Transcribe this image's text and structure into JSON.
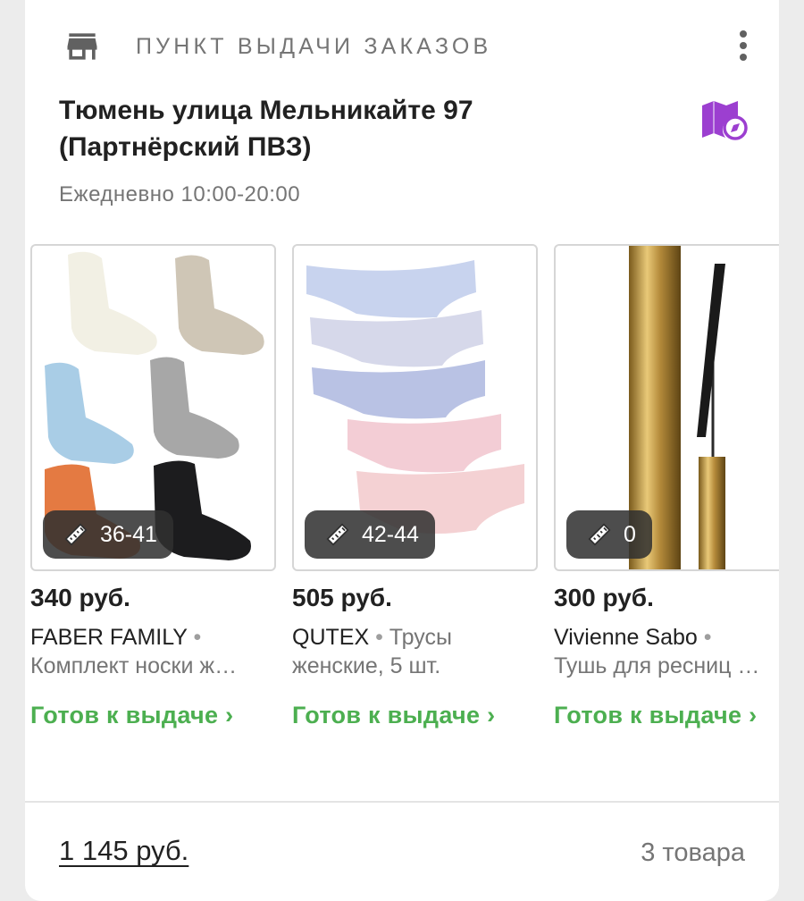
{
  "pickup": {
    "title": "ПУНКТ ВЫДАЧИ ЗАКАЗОВ",
    "address": "Тюмень улица Мельникайте 97 (Партнёрский ПВЗ)",
    "hours": "Ежедневно 10:00-20:00",
    "icons": {
      "store": "store-icon",
      "menu": "more-vert-icon",
      "map": "map-compass-icon"
    },
    "accent_color": "#9c3fd0"
  },
  "products": [
    {
      "size": "36-41",
      "price": "340 руб.",
      "brand": "FABER FAMILY",
      "separator": " •",
      "line2": "Комплект носки ж…",
      "status": "Готов к выдаче ›",
      "image": "socks"
    },
    {
      "size": "42-44",
      "price": "505 руб.",
      "brand": "QUTEX",
      "separator": " •",
      "line1_rest": " Трусы",
      "line2": "женские, 5 шт.",
      "status": "Готов к выдаче ›",
      "image": "briefs"
    },
    {
      "size": "0",
      "price": "300 руб.",
      "brand": "Vivienne Sabo",
      "separator": " •",
      "line2": "Тушь для ресниц …",
      "status": "Готов к выдаче ›",
      "image": "mascara"
    }
  ],
  "summary": {
    "total": "1 145 руб.",
    "count": "3 товара"
  },
  "colors": {
    "status": "#4caf50",
    "muted": "#757575"
  }
}
